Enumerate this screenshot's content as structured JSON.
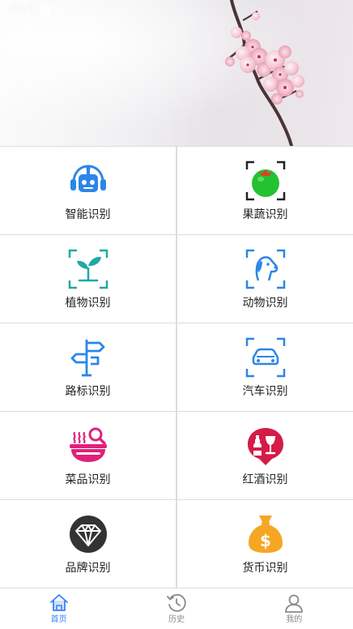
{
  "status_bar": {
    "time": "3:15"
  },
  "banner": {
    "image": "cherry-blossom-branch-photo"
  },
  "grid": [
    {
      "label": "智能识别",
      "icon": "robot-headset-icon",
      "color": "#2b86e8"
    },
    {
      "label": "果蔬识别",
      "icon": "tomato-scan-icon",
      "color": "#22b14c"
    },
    {
      "label": "植物识别",
      "icon": "sprout-scan-icon",
      "color": "#1fa9a6"
    },
    {
      "label": "动物识别",
      "icon": "dog-scan-icon",
      "color": "#2b86e8"
    },
    {
      "label": "路标识别",
      "icon": "signpost-icon",
      "color": "#2b86e8"
    },
    {
      "label": "汽车识别",
      "icon": "car-scan-icon",
      "color": "#2b86e8"
    },
    {
      "label": "菜品识别",
      "icon": "dish-search-icon",
      "color": "#e0217a"
    },
    {
      "label": "红酒识别",
      "icon": "wine-pin-icon",
      "color": "#d51b47"
    },
    {
      "label": "品牌识别",
      "icon": "diamond-icon",
      "color": "#333333"
    },
    {
      "label": "货币识别",
      "icon": "money-bag-icon",
      "color": "#f5a623"
    }
  ],
  "bottom_nav": {
    "active": 0,
    "items": [
      {
        "label": "首页",
        "icon": "home-icon"
      },
      {
        "label": "历史",
        "icon": "history-icon"
      },
      {
        "label": "我的",
        "icon": "profile-icon"
      }
    ],
    "active_color": "#3b82f6",
    "inactive_color": "#8a8a8a"
  }
}
